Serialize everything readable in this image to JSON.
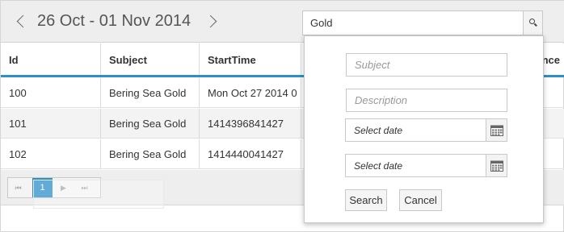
{
  "toolbar": {
    "date_range": "26 Oct - 01 Nov 2014",
    "search_value": "Gold"
  },
  "grid": {
    "columns": [
      "Id",
      "Subject",
      "StartTime",
      "nce"
    ],
    "rows": [
      [
        "100",
        "Bering Sea Gold",
        "Mon Oct 27 2014 0"
      ],
      [
        "101",
        "Bering Sea Gold",
        "1414396841427"
      ],
      [
        "102",
        "Bering Sea Gold",
        "1414440041427"
      ]
    ]
  },
  "pager": {
    "first": "⏮",
    "prev": "▶",
    "page": "1",
    "next": "▶",
    "last": "⏭"
  },
  "popup": {
    "subject_placeholder": "Subject",
    "description_placeholder": "Description",
    "start_date_placeholder": "Select date",
    "end_date_placeholder": "Select date",
    "search_label": "Search",
    "cancel_label": "Cancel"
  },
  "colors": {
    "accent": "#2c8fc9",
    "toolbar_bg": "#eeeeee"
  }
}
